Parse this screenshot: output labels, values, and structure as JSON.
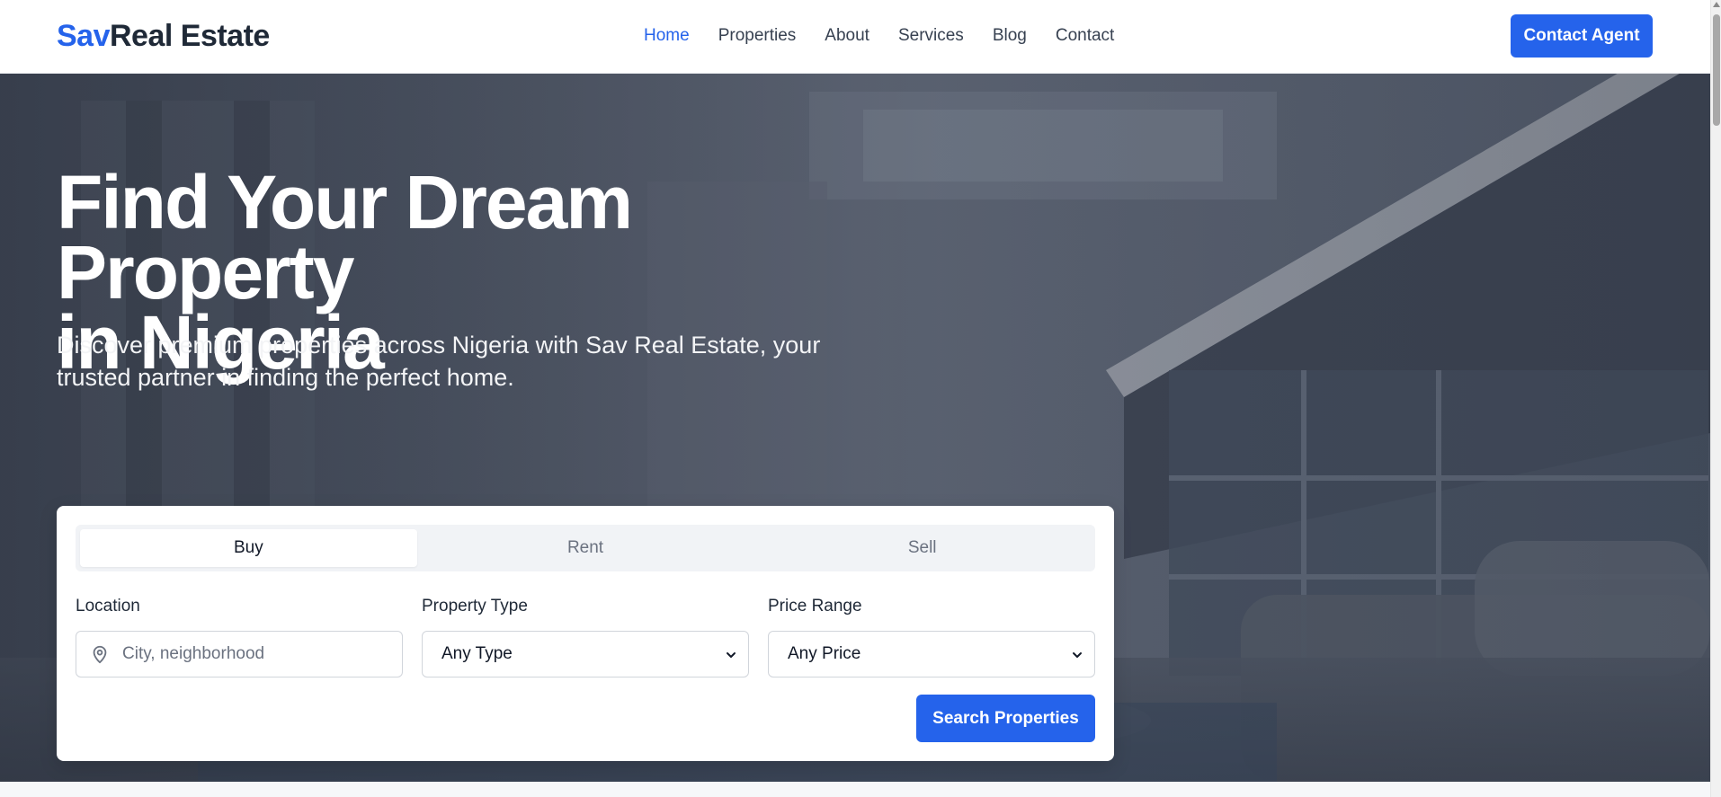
{
  "header": {
    "logo_accent": "Sav",
    "logo_rest": "Real Estate",
    "nav": [
      {
        "label": "Home",
        "active": true
      },
      {
        "label": "Properties",
        "active": false
      },
      {
        "label": "About",
        "active": false
      },
      {
        "label": "Services",
        "active": false
      },
      {
        "label": "Blog",
        "active": false
      },
      {
        "label": "Contact",
        "active": false
      }
    ],
    "cta_label": "Contact Agent"
  },
  "hero": {
    "title_line1": "Find Your Dream Property",
    "title_line2": "in Nigeria",
    "subtitle": "Discover premium properties across Nigeria with Sav Real Estate, your trusted partner in finding the perfect home."
  },
  "search": {
    "tabs": [
      {
        "label": "Buy",
        "active": true
      },
      {
        "label": "Rent",
        "active": false
      },
      {
        "label": "Sell",
        "active": false
      }
    ],
    "location": {
      "label": "Location",
      "placeholder": "City, neighborhood",
      "value": ""
    },
    "property_type": {
      "label": "Property Type",
      "selected": "Any Type"
    },
    "price_range": {
      "label": "Price Range",
      "selected": "Any Price"
    },
    "submit_label": "Search Properties"
  },
  "icons": {
    "location": "map-pin-icon",
    "chevron": "chevron-down-icon"
  },
  "colors": {
    "accent": "#2563eb",
    "text_dark": "#1f2937",
    "muted": "#6b7280"
  }
}
